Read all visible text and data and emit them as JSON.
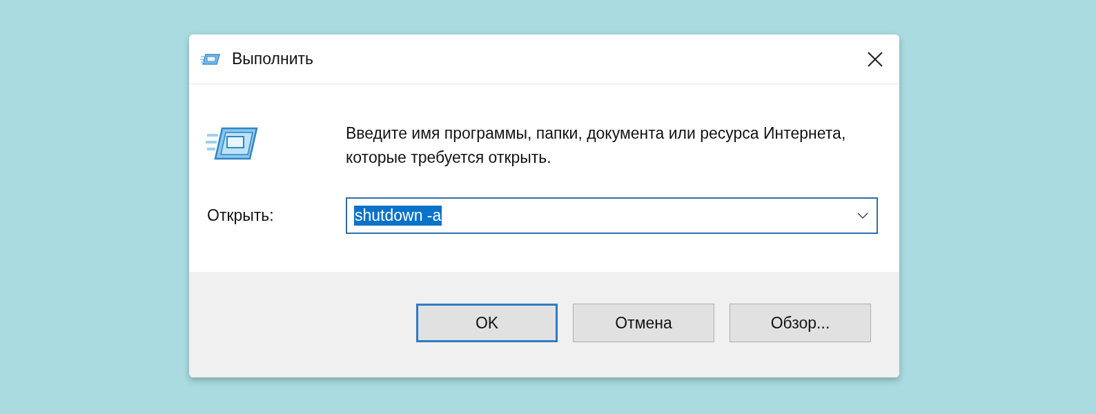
{
  "window": {
    "title": "Выполнить"
  },
  "prompt": "Введите имя программы, папки, документа или ресурса Интернета, которые требуется открыть.",
  "open_field": {
    "label": "Открыть:",
    "value": "shutdown -a",
    "text_selected": true
  },
  "buttons": [
    {
      "label": "OK",
      "default": true
    },
    {
      "label": "Отмена",
      "default": false
    },
    {
      "label": "Обзор...",
      "default": false
    }
  ]
}
